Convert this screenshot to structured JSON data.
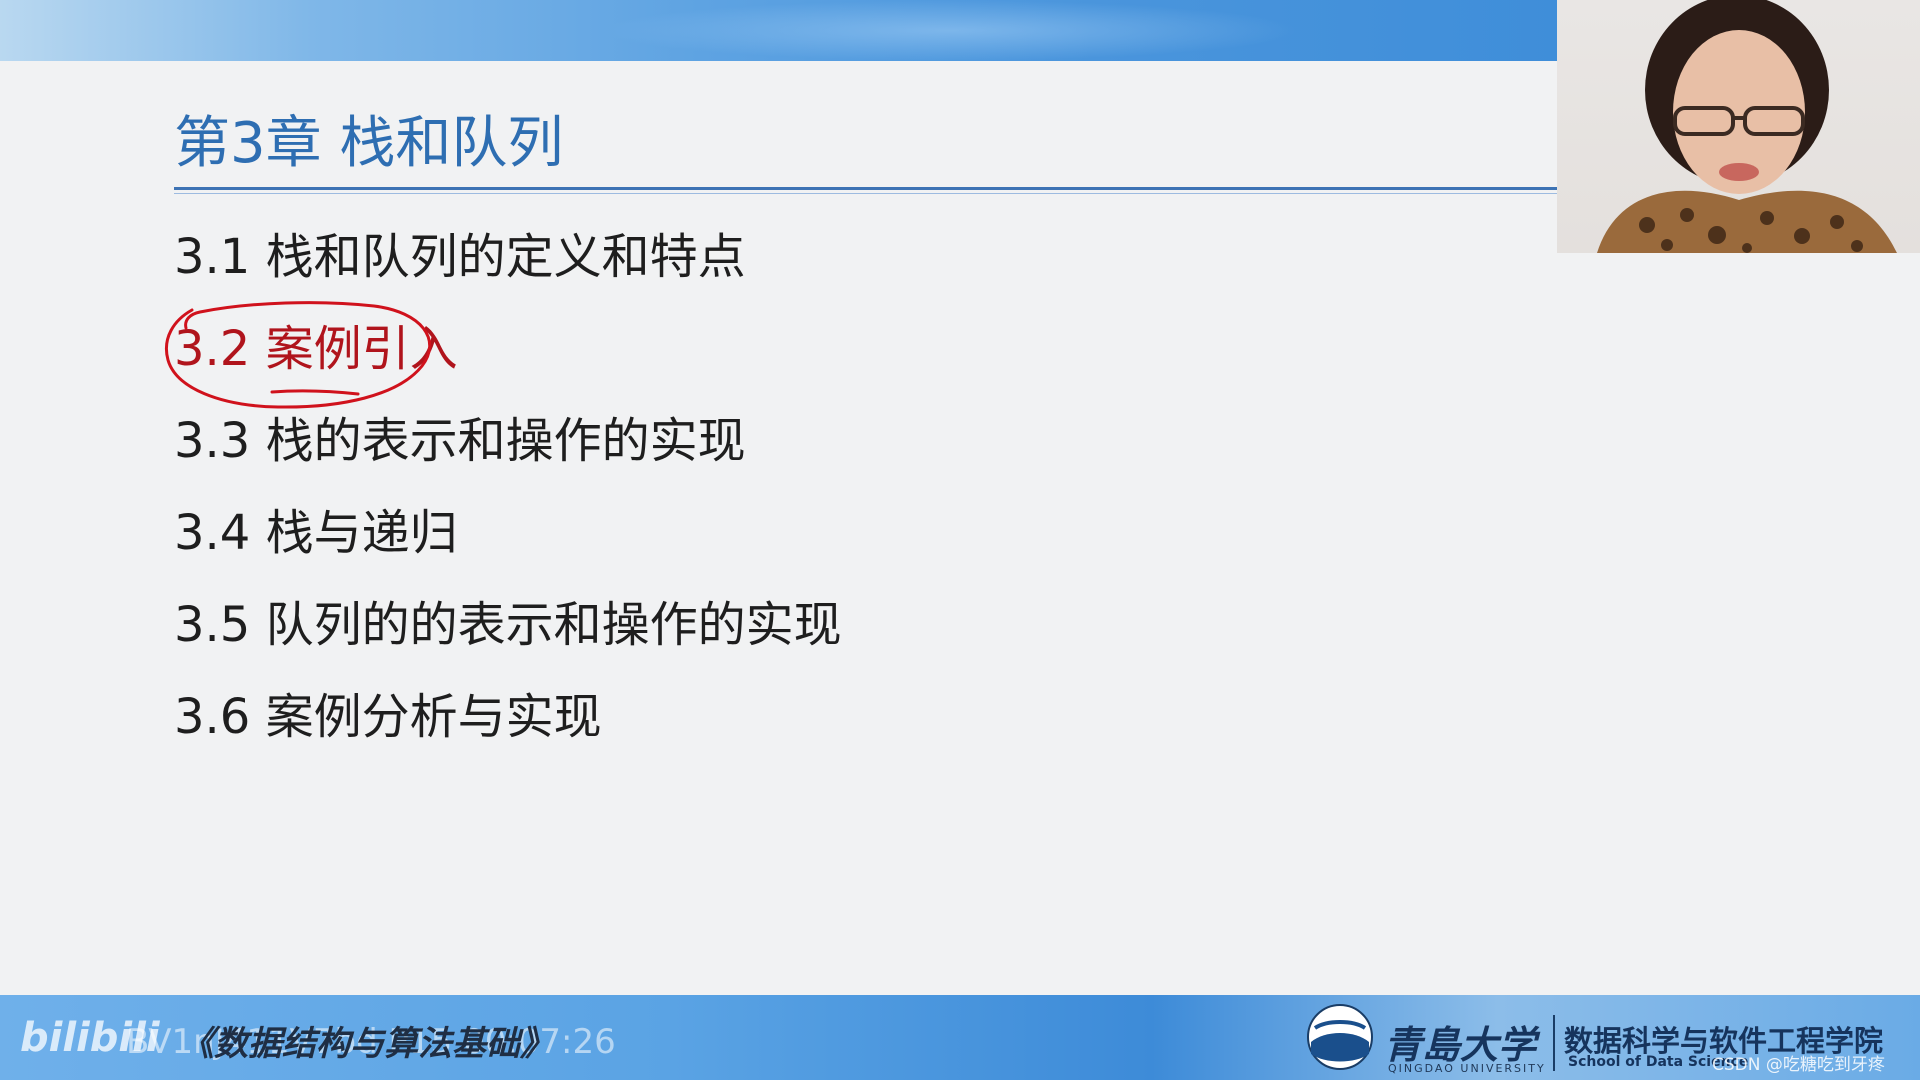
{
  "slide": {
    "title": "第3章 栈和队列",
    "items": [
      {
        "label": "3.1 栈和队列的定义和特点"
      },
      {
        "label": "3.2 案例引入"
      },
      {
        "label": "3.3 栈的表示和操作的实现"
      },
      {
        "label": "3.4 栈与递归"
      },
      {
        "label": "3.5 队列的的表示和操作的实现"
      },
      {
        "label": "3.6 案例分析与实现"
      }
    ],
    "highlighted_index": 1
  },
  "footer": {
    "platform_logo": "bilibili",
    "video_watermark": "BV1nJ411V7bd P15 00:07:26",
    "course_name": "《数据结构与算法基础》",
    "university_cn": "青島大学",
    "university_en": "QINGDAO UNIVERSITY",
    "school_cn": "数据科学与软件工程学院",
    "school_en": "School of Data Science",
    "csdn_watermark": "CSDN @吃糖吃到牙疼"
  },
  "colors": {
    "title": "#2e6eb2",
    "text": "#1e1e1e",
    "highlight": "#b0141c",
    "annotation": "#d0121c",
    "bar_blue": "#3d8bd8"
  },
  "icons": [
    "webcam-presenter",
    "university-emblem-icon",
    "bilibili-logo"
  ]
}
